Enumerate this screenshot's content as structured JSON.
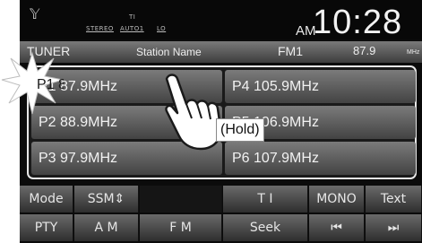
{
  "status": {
    "antenna_icon": "antenna-icon",
    "ti": "TI",
    "stereo": "STEREO",
    "auto": "AUTO1",
    "lo": "LO",
    "ampm": "AM",
    "time": "10:28"
  },
  "header": {
    "source": "TUNER",
    "station_name": "Station Name",
    "band": "FM1",
    "frequency": "87.9",
    "unit": "MHz"
  },
  "presets": [
    {
      "label": "P1  87.9MHz"
    },
    {
      "label": "P2  88.9MHz"
    },
    {
      "label": "P3  97.9MHz"
    },
    {
      "label": "P4  105.9MHz"
    },
    {
      "label": "P5  106.9MHz"
    },
    {
      "label": "P6  107.9MHz"
    }
  ],
  "buttons_row1": [
    "Mode",
    "SSM⇕",
    "",
    "T I",
    "MONO",
    "Text"
  ],
  "buttons_row2": [
    "PTY",
    "A M",
    "F M",
    "Seek",
    "⏮",
    "⏭"
  ],
  "hold_label": "(Hold)",
  "colors": {
    "button_gradient_top": "#7b7b7b",
    "button_gradient_bottom": "#434343",
    "panel_border": "#e8e8e8"
  }
}
